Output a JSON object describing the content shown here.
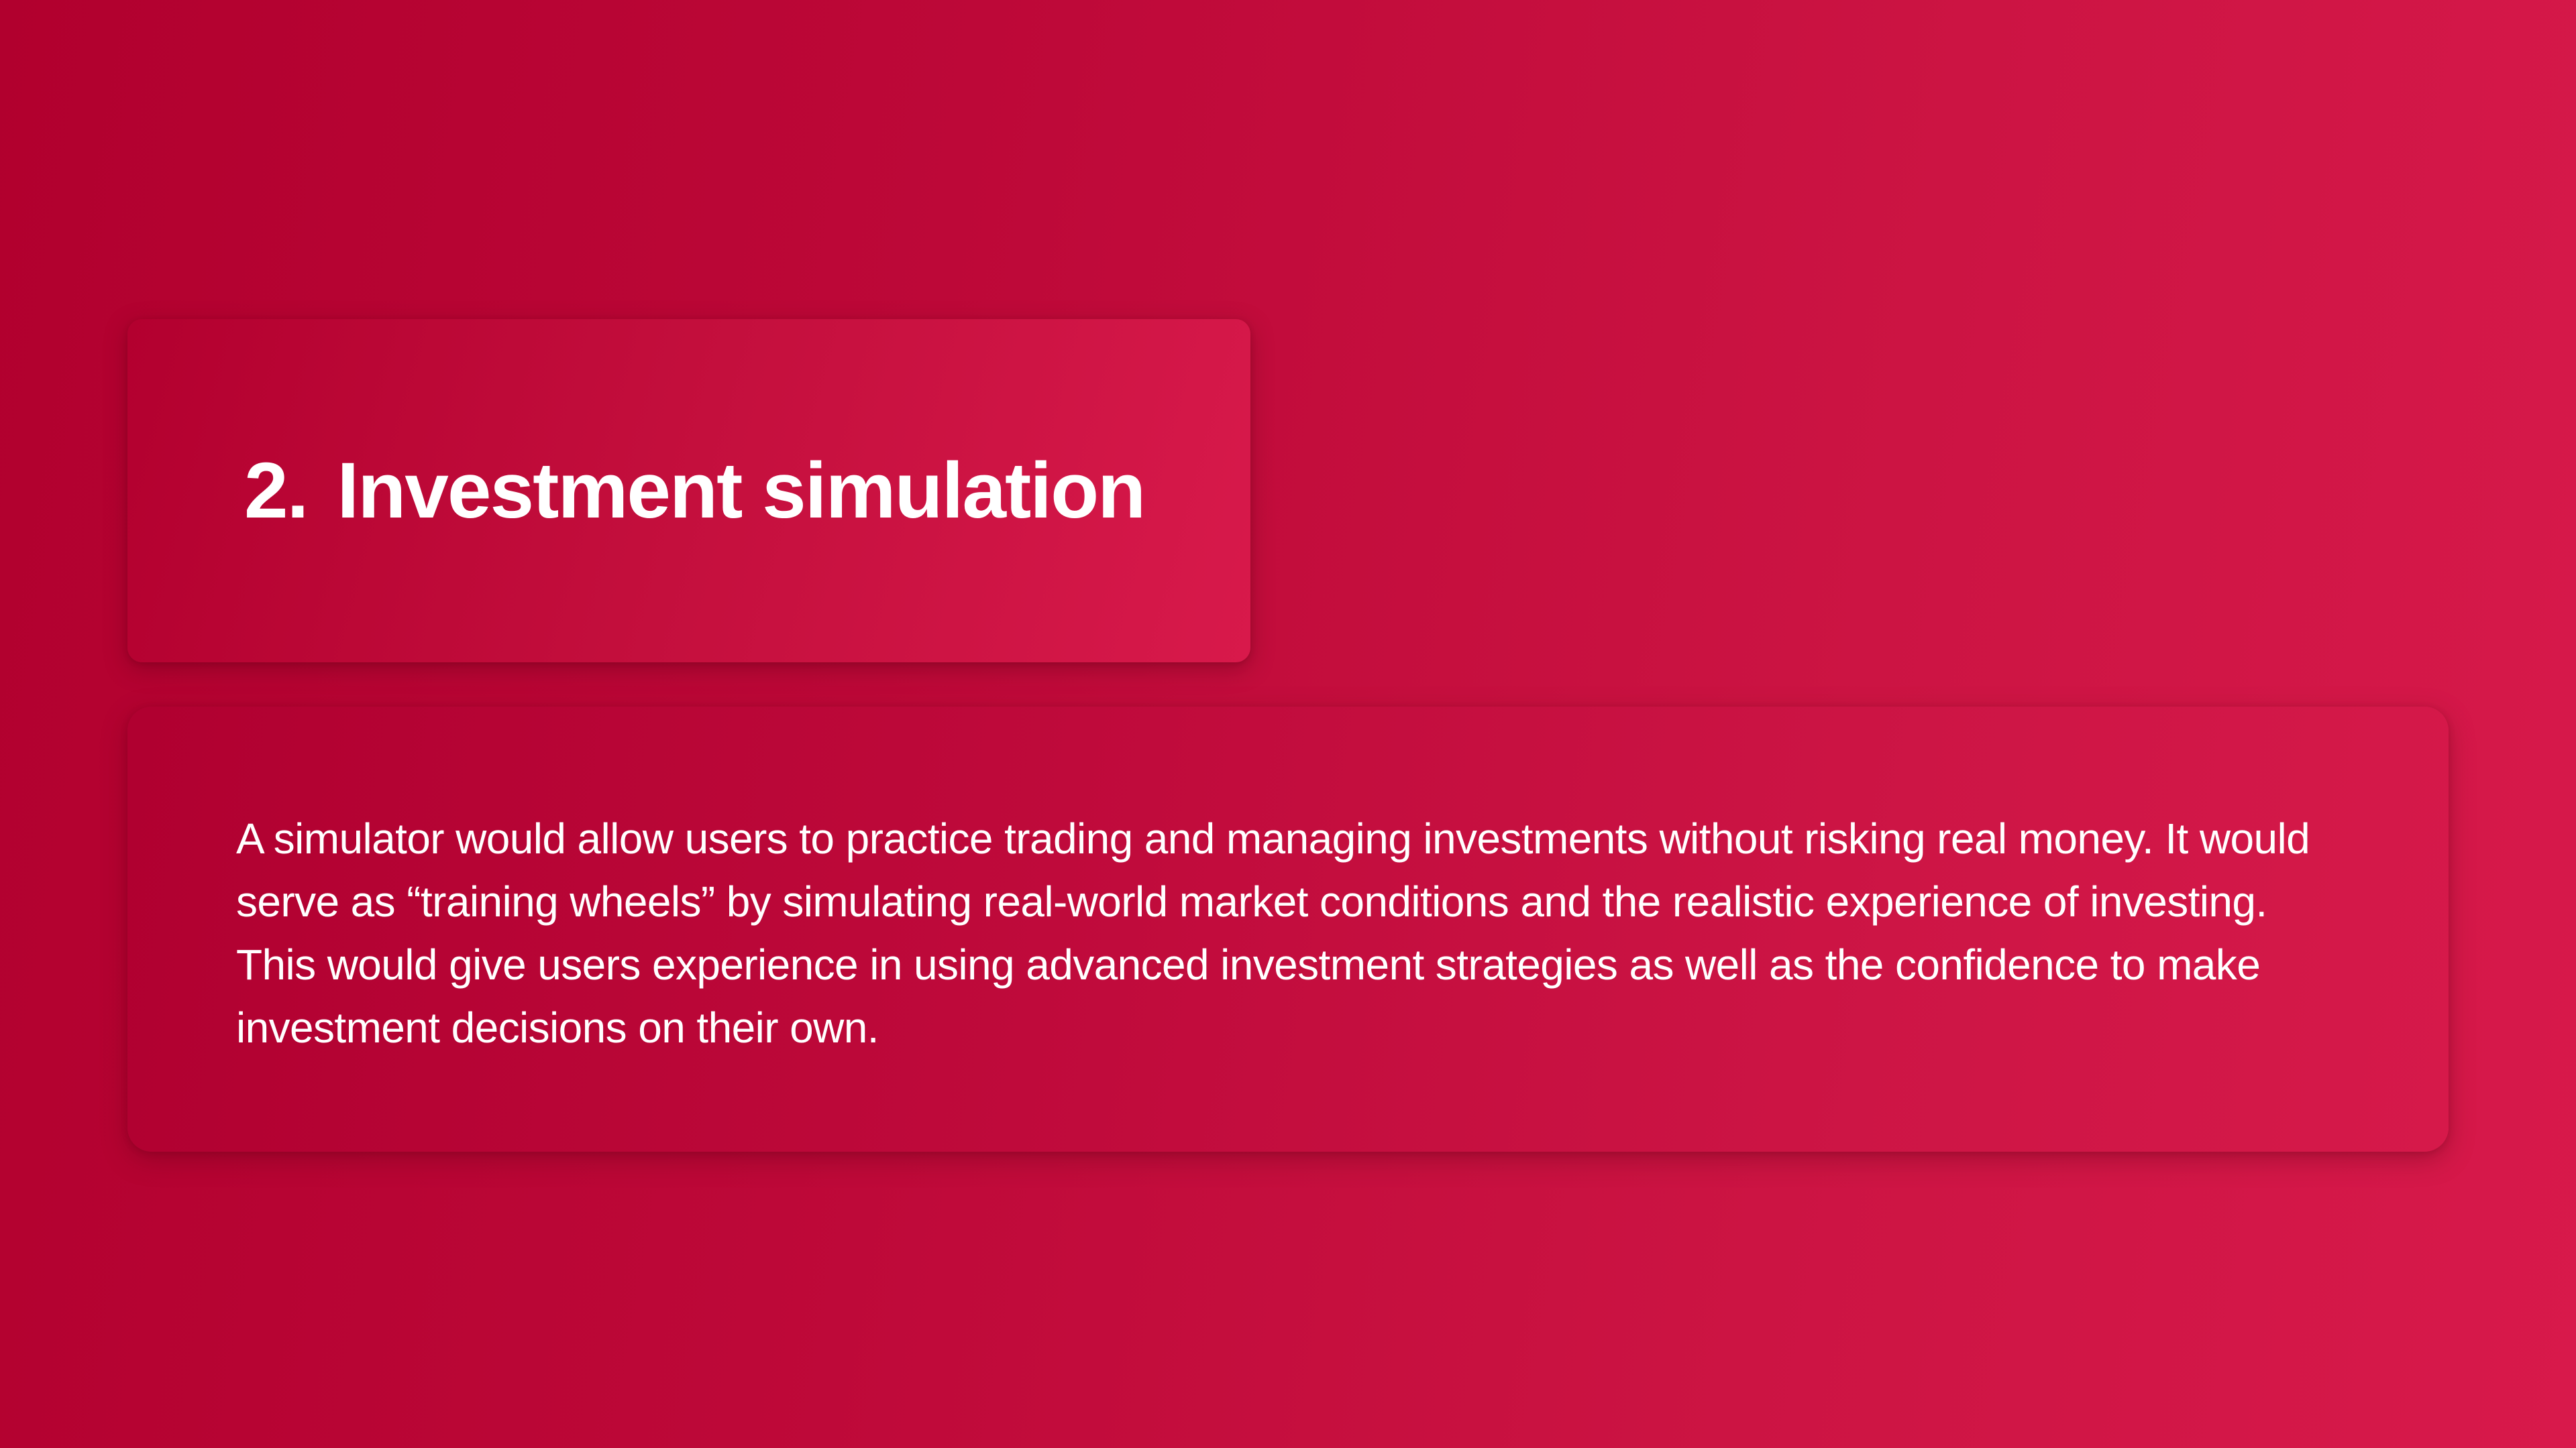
{
  "slide": {
    "heading": {
      "number": "2.",
      "title": "Investment simulation"
    },
    "body": {
      "paragraph": "A simulator would allow users to practice trading and managing investments without risking real money. It would serve as “training wheels” by simulating real-world market conditions and the realistic experience of investing. This would give users experience in using advanced investment strategies as well as the confidence to make investment decisions on their own."
    }
  },
  "colors": {
    "background_start": "#b1002e",
    "background_end": "#d8194b",
    "text": "#ffffff"
  }
}
